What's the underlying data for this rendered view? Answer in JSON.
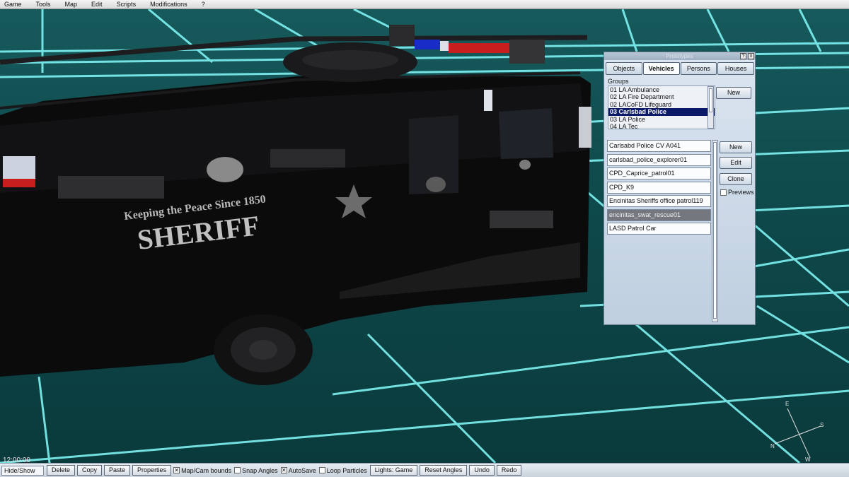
{
  "menu": [
    "Game",
    "Tools",
    "Map",
    "Edit",
    "Scripts",
    "Modifications",
    "?"
  ],
  "panel": {
    "title": "Prototypes",
    "help_label": "?",
    "close_label": "x",
    "tabs": [
      "Objects",
      "Vehicles",
      "Persons",
      "Houses"
    ],
    "active_tab": "Vehicles",
    "groups_label": "Groups",
    "groups": [
      "01 LA Ambulance",
      "02 LA Fire Department",
      "02 LACoFD Lifeguard",
      "03 Carlsbad Police",
      "03 LA Police",
      "04 LA Tec"
    ],
    "selected_group": "03 Carlsbad Police",
    "groups_new_label": "New",
    "prototypes": [
      "Carlsabd Police CV A041",
      "carlsbad_police_explorer01",
      "CPD_Caprice_patrol01",
      "CPD_K9",
      "Encinitas Sheriffs office patrol119",
      "encinitas_swat_rescue01",
      "LASD Patrol Car"
    ],
    "selected_prototype": "encinitas_swat_rescue01",
    "buttons": {
      "new": "New",
      "edit": "Edit",
      "clone": "Clone"
    },
    "previews_label": "Previews",
    "previews_checked": false
  },
  "scene": {
    "time": "12:00:00",
    "vehicle_slogan": "Keeping the Peace Since 1850",
    "vehicle_text": "SHERIFF",
    "compass": {
      "n": "N",
      "s": "S",
      "e": "E",
      "w": "W"
    }
  },
  "toolbar": {
    "hide_show": "Hide/Show",
    "delete": "Delete",
    "copy": "Copy",
    "paste": "Paste",
    "properties": "Properties",
    "map_cam_bounds": "Map/Cam bounds",
    "map_cam_bounds_checked": true,
    "snap_angles": "Snap Angles",
    "snap_angles_checked": false,
    "autosave": "AutoSave",
    "autosave_checked": true,
    "loop_particles": "Loop Particles",
    "loop_particles_checked": false,
    "lights": "Lights: Game",
    "reset_angles": "Reset Angles",
    "undo": "Undo",
    "redo": "Redo"
  },
  "colors": {
    "grid_line": "#7ff2f2",
    "floor": "#0f4a4c",
    "selection": "#0a1a66",
    "light_red": "#c81e1e",
    "light_blue": "#1a2cc8"
  }
}
